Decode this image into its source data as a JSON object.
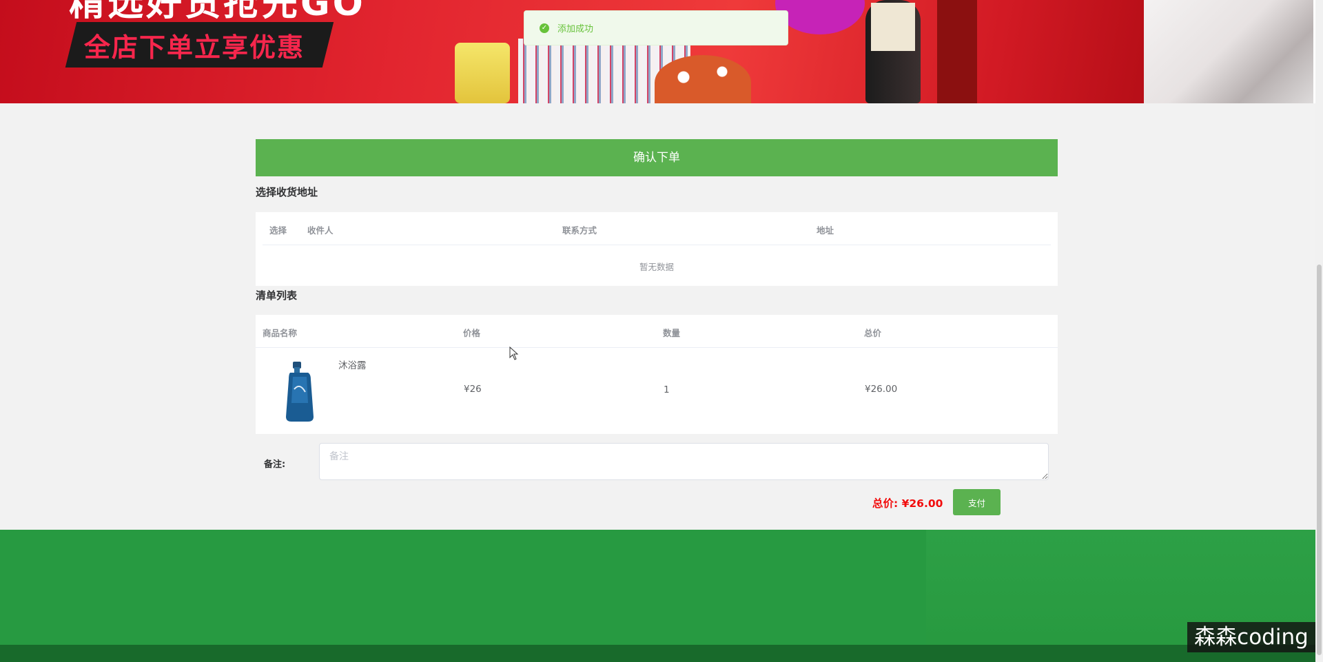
{
  "banner": {
    "headline": "精选好货抢先GO",
    "promo": "全店下单立享优惠"
  },
  "toast": {
    "message": "添加成功",
    "icon": "check-circle-icon",
    "color": "#67c23a"
  },
  "order": {
    "confirm_title": "确认下单",
    "address_section_title": "选择收货地址",
    "address_columns": [
      "选择",
      "收件人",
      "联系方式",
      "地址"
    ],
    "address_empty_text": "暂无数据",
    "list_section_title": "清单列表",
    "list_columns": [
      "商品名称",
      "价格",
      "数量",
      "总价"
    ],
    "items": [
      {
        "name": "沐浴露",
        "price": "¥26",
        "quantity": "1",
        "total": "¥26.00",
        "image_icon": "shower-gel-bottle"
      }
    ],
    "remark_label": "备注:",
    "remark_placeholder": "备注",
    "total_label": "总价: ¥26.00",
    "pay_button": "支付"
  },
  "watermark": "森森coding",
  "colors": {
    "primary_green": "#5bb250",
    "footer_green": "#279a41",
    "price_red": "#f20c0c"
  }
}
